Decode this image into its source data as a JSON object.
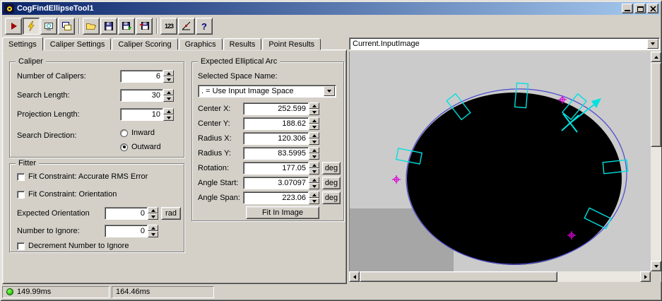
{
  "window": {
    "title": "CogFindEllipseTool1"
  },
  "toolbar": {
    "num123_label": "123",
    "help_label": "?"
  },
  "tabs": {
    "items": [
      "Settings",
      "Caliper Settings",
      "Caliper Scoring",
      "Graphics",
      "Results",
      "Point Results"
    ],
    "active": "Settings"
  },
  "caliper": {
    "legend": "Caliper",
    "number_of_calipers": {
      "label": "Number of Calipers:",
      "value": "6"
    },
    "search_length": {
      "label": "Search Length:",
      "value": "30"
    },
    "projection_length": {
      "label": "Projection Length:",
      "value": "10"
    },
    "search_direction": {
      "label": "Search Direction:",
      "inward": "Inward",
      "outward": "Outward",
      "selected": "Outward"
    }
  },
  "fitter": {
    "legend": "Fitter",
    "rms_label": "Fit Constraint: Accurate RMS Error",
    "orientation_label": "Fit Constraint: Orientation",
    "expected_orientation": {
      "label": "Expected Orientation",
      "value": "0",
      "unit": "rad"
    },
    "number_to_ignore": {
      "label": "Number to Ignore:",
      "value": "0"
    },
    "decrement_label": "Decrement Number to Ignore"
  },
  "arc": {
    "legend": "Expected Elliptical Arc",
    "space_name_label": "Selected Space Name:",
    "space_name_value": ". = Use Input Image Space",
    "center_x": {
      "label": "Center X:",
      "value": "252.599"
    },
    "center_y": {
      "label": "Center Y:",
      "value": "188.62"
    },
    "radius_x": {
      "label": "Radius X:",
      "value": "120.306"
    },
    "radius_y": {
      "label": "Radius Y:",
      "value": "83.5995"
    },
    "rotation": {
      "label": "Rotation:",
      "value": "177.05",
      "unit": "deg"
    },
    "angle_start": {
      "label": "Angle Start:",
      "value": "3.07097",
      "unit": "deg"
    },
    "angle_span": {
      "label": "Angle Span:",
      "value": "223.06",
      "unit": "deg"
    },
    "fit_in_image_label": "Fit In Image"
  },
  "display": {
    "image_selector": "Current.InputImage"
  },
  "statusbar": {
    "time1": "149.99ms",
    "time2": "164.46ms"
  }
}
